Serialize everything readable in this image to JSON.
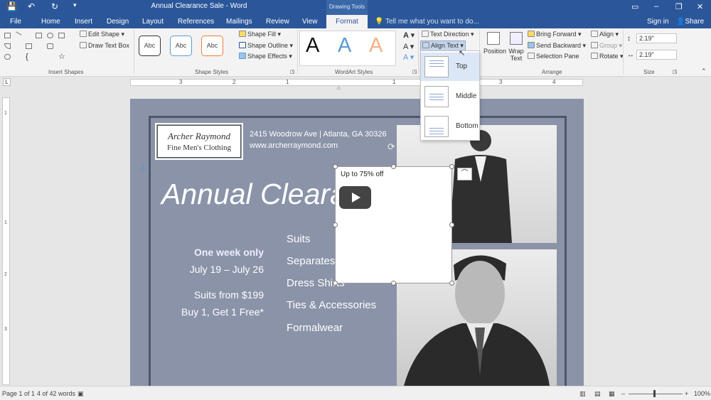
{
  "window": {
    "title": "Annual Clearance Sale - Word",
    "contextual_tab_group": "Drawing Tools",
    "controls": [
      "?",
      "▭",
      "–",
      "❐",
      "✕"
    ]
  },
  "quick_access": {
    "save": "💾",
    "undo": "↶",
    "redo": "↻",
    "more": "▾"
  },
  "tabs": [
    {
      "label": "File"
    },
    {
      "label": "Home"
    },
    {
      "label": "Insert"
    },
    {
      "label": "Design"
    },
    {
      "label": "Layout"
    },
    {
      "label": "References"
    },
    {
      "label": "Mailings"
    },
    {
      "label": "Review"
    },
    {
      "label": "View"
    },
    {
      "label": "Format",
      "active": true
    }
  ],
  "tell_me": "Tell me what you want to do...",
  "sign_in": "Sign in",
  "share": "Share",
  "ribbon": {
    "insert_shapes": {
      "label": "Insert Shapes",
      "edit_shape": "Edit Shape",
      "draw_text_box": "Draw Text Box"
    },
    "shape_styles": {
      "label": "Shape Styles",
      "presets": [
        "Abc",
        "Abc",
        "Abc"
      ],
      "preset_colors": [
        "#333333",
        "#5b9bd5",
        "#ed7d31"
      ],
      "shape_fill": "Shape Fill",
      "shape_outline": "Shape Outline",
      "shape_effects": "Shape Effects"
    },
    "wordart_styles": {
      "label": "WordArt Styles",
      "samples": [
        "A",
        "A",
        "A"
      ],
      "sample_colors": [
        "#111111",
        "#5b9bd5",
        "#f4b183"
      ]
    },
    "text": {
      "text_direction": "Text Direction",
      "align_text": "Align Text"
    },
    "arrange": {
      "label": "Arrange",
      "position": "Position",
      "wrap_text_1": "Wrap",
      "wrap_text_2": "Text",
      "bring_forward": "Bring Forward",
      "send_backward": "Send Backward",
      "selection_pane": "Selection Pane",
      "align": "Align",
      "group": "Group",
      "rotate": "Rotate"
    },
    "size": {
      "label": "Size",
      "height": "2.19\"",
      "width": "2.19\""
    }
  },
  "align_text_menu": [
    {
      "label": "Top",
      "selected": true
    },
    {
      "label": "Middle",
      "selected": false
    },
    {
      "label": "Bottom",
      "selected": false
    }
  ],
  "ruler": {
    "h_numbers": [
      "3",
      "2",
      "1",
      "1",
      "2",
      "3",
      "4"
    ],
    "v_numbers": [
      "1",
      "1",
      "2",
      "3"
    ]
  },
  "document": {
    "logo_line1": "Archer Raymond",
    "logo_line2": "Fine Men's Clothing",
    "address": "2415 Woodrow Ave | Atlanta, GA 30326",
    "website": "www.archerraymond.com",
    "headline": "Annual Clearance Sale",
    "one_week": "One week only",
    "dates": "July 19 – July 26",
    "suits_from": "Suits from $199",
    "bogo": "Buy 1, Get 1 Free*",
    "categories": [
      "Suits",
      "Separates",
      "Dress Shirts",
      "Ties & Accessories",
      "Formalwear"
    ],
    "textbox_text": "Up to 75% off",
    "accent_color": "#8a93a8"
  },
  "status": {
    "page": "Page 1 of 1",
    "words": "4 of 42 words",
    "zoom": "100%",
    "zoom_minus": "–",
    "zoom_plus": "+"
  }
}
